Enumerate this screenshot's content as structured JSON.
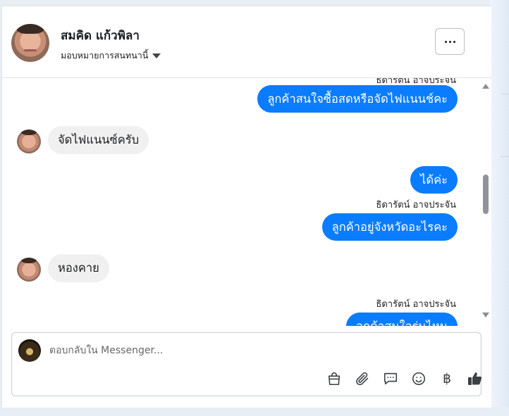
{
  "header": {
    "contact_name": "สมคิด แก้วพิลา",
    "assign_label": "มอบหมายการสนทนานี้"
  },
  "messages": [
    {
      "direction": "outgoing",
      "sender": "ธิดารัตน์ อาจประจัน",
      "text": "ลูกค้าสนใจซื้อสดหรือจัดไฟแนนช์คะ"
    },
    {
      "direction": "incoming",
      "text": "จัดไฟแนนซ์ครับ"
    },
    {
      "direction": "outgoing",
      "text": "ได้ค่ะ"
    },
    {
      "direction": "outgoing",
      "sender": "ธิดารัตน์ อาจประจัน",
      "text": "ลูกค้าอยู่จังหวัดอะไรคะ"
    },
    {
      "direction": "incoming",
      "text": "หองคาย"
    },
    {
      "direction": "outgoing",
      "sender": "ธิดารัตน์ อาจประจัน",
      "text": "ลูกค้าสนใจรุ่นไหน"
    }
  ],
  "composer": {
    "placeholder": "ตอบกลับใน Messenger...",
    "tools": [
      "shopping-bag-icon",
      "paperclip-icon",
      "chat-reply-icon",
      "emoji-icon",
      "baht-icon",
      "thumbs-up-icon"
    ],
    "baht_symbol": "฿"
  },
  "colors": {
    "outgoing_bubble": "#0a7cff",
    "incoming_bubble": "#f0f0f0"
  }
}
